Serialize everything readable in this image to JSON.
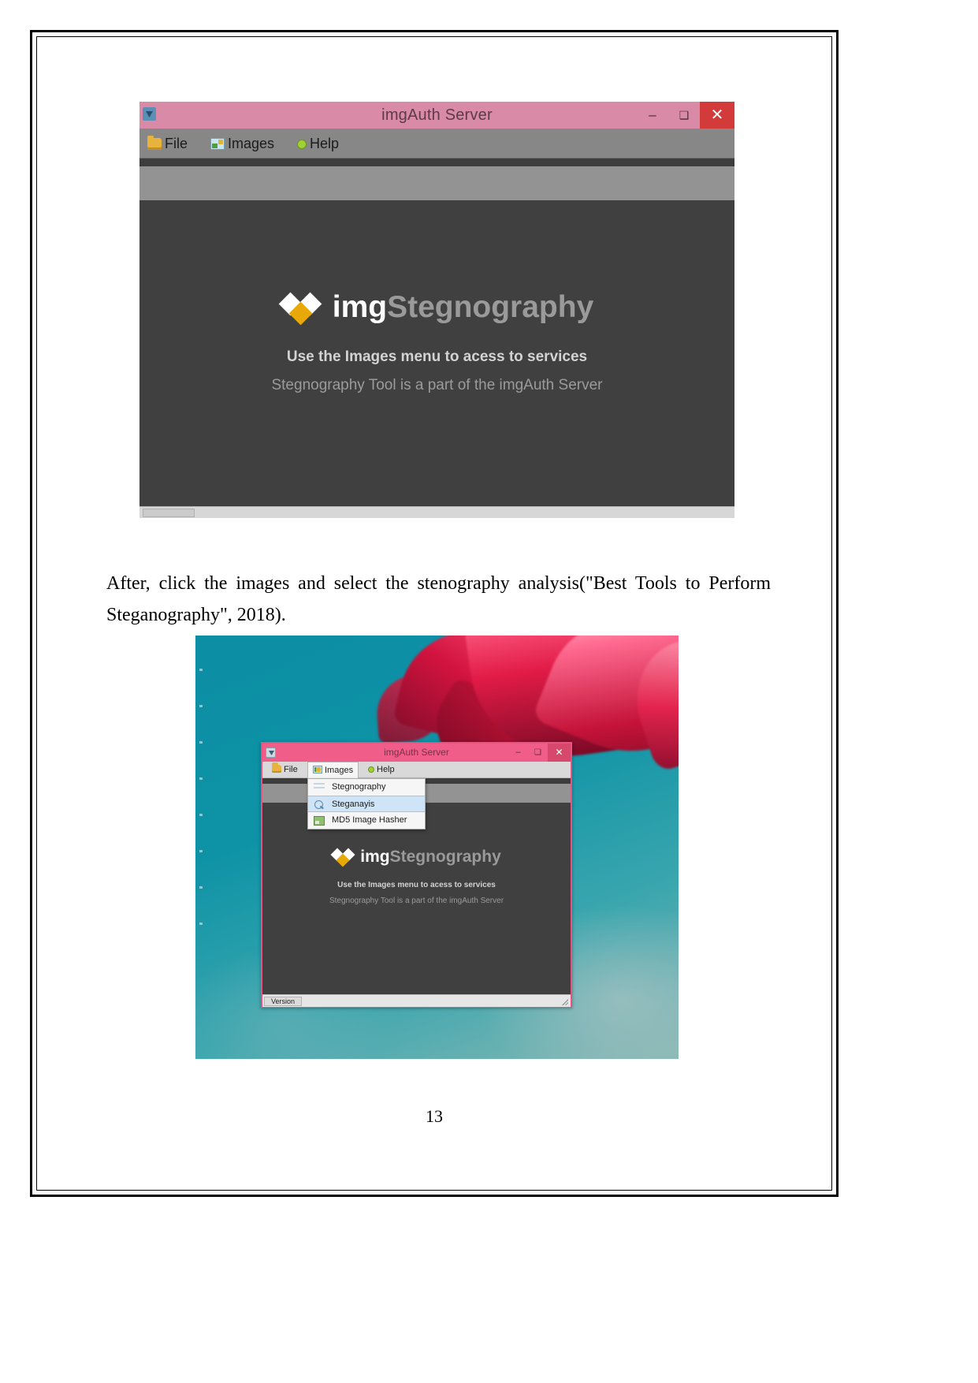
{
  "document": {
    "page_number": "13",
    "paragraph": "After, click the images and select the stenography analysis(\"Best Tools to Perform Steganography\", 2018)."
  },
  "figure1": {
    "window": {
      "title": "imgAuth Server",
      "app_icon": "app-icon",
      "controls": {
        "minimize": "–",
        "maximize": "❑",
        "close": "✕"
      },
      "menubar": [
        {
          "label_pre": "F",
          "label_underline": "i",
          "label_post": "le",
          "full": "File",
          "icon": "folder-icon"
        },
        {
          "label_pre": "I",
          "label_underline": "m",
          "label_post": "ages",
          "full": "Images",
          "icon": "images-icon"
        },
        {
          "label_pre": "",
          "label_underline": "H",
          "label_post": "elp",
          "full": "Help",
          "icon": "green-bullet-icon"
        }
      ],
      "logo": {
        "part1": "img",
        "part2": "Stegnography",
        "diamond_white": "#ffffff",
        "diamond_gold": "#e8a808"
      },
      "tagline1": "Use the Images menu to acess to services",
      "tagline2": "Stegnography Tool is a part of the imgAuth Server",
      "titlebar_color": "#d98aa6",
      "body_color": "#404040"
    }
  },
  "figure2": {
    "desktop": {
      "wallpaper_description": "teal background with red flower petals"
    },
    "window": {
      "title": "imgAuth Server",
      "controls": {
        "minimize": "–",
        "maximize": "❑",
        "close": "✕"
      },
      "menubar": [
        {
          "full": "File",
          "icon": "folder-icon"
        },
        {
          "full": "Images",
          "icon": "images-icon"
        },
        {
          "full": "Help",
          "icon": "green-bullet-icon"
        }
      ],
      "dropdown": {
        "open_for": "Images",
        "items": [
          {
            "label": "Stegnography",
            "icon": "lines-icon",
            "selected": false
          },
          {
            "label": "Steganayis",
            "icon": "magnifier-icon",
            "selected": true
          },
          {
            "label": "MD5 Image Hasher",
            "icon": "md5-icon",
            "selected": false
          }
        ]
      },
      "logo": {
        "part1": "img",
        "part2": "Stegnography"
      },
      "tagline1": "Use the Images menu to acess to services",
      "tagline2": "Stegnography Tool is a part of the imgAuth Server",
      "status_label": "Version",
      "titlebar_color": "#ef5d88"
    }
  }
}
